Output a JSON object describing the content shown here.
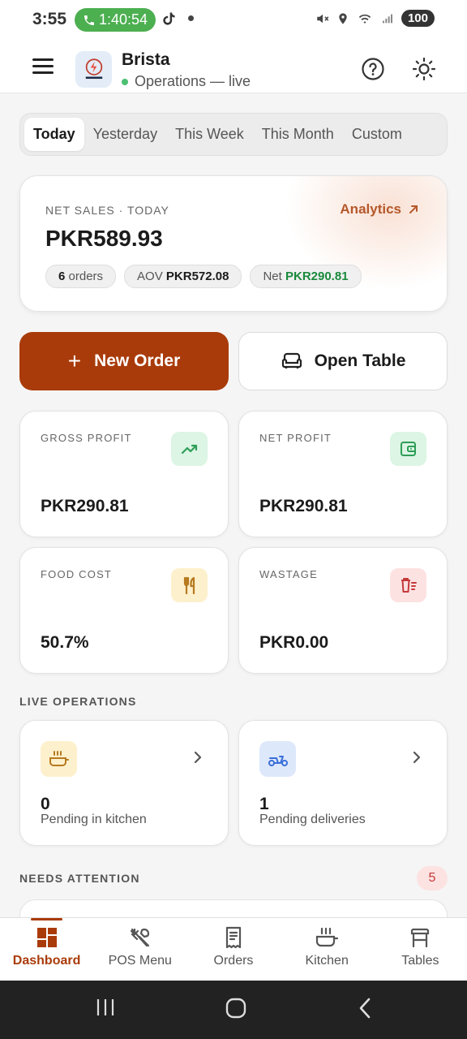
{
  "status_bar": {
    "time": "3:55",
    "call_timer": "1:40:54",
    "battery": "100",
    "icons": [
      "phone-icon",
      "tiktok-icon",
      "mute-icon",
      "location-icon",
      "wifi-icon",
      "signal-icon",
      "battery-icon"
    ]
  },
  "header": {
    "brand": "Brista",
    "status": "Operations — live",
    "icons": [
      "menu-icon",
      "help-icon",
      "theme-icon"
    ]
  },
  "tabs": [
    "Today",
    "Yesterday",
    "This Week",
    "This Month",
    "Custom"
  ],
  "active_tab": "Today",
  "sales": {
    "label": "NET SALES · TODAY",
    "analytics": "Analytics",
    "value": "PKR589.93",
    "orders_count": "6",
    "orders_suffix": "orders",
    "aov_label": "AOV",
    "aov_value": "PKR572.08",
    "net_label": "Net",
    "net_value": "PKR290.81"
  },
  "actions": {
    "new_order": "New Order",
    "open_table": "Open Table"
  },
  "metrics": {
    "gross_profit": {
      "label": "GROSS PROFIT",
      "value": "PKR290.81",
      "icon": "trending-up-icon",
      "color": "#2e9e57"
    },
    "net_profit": {
      "label": "NET PROFIT",
      "value": "PKR290.81",
      "icon": "wallet-icon",
      "color": "#2e9e57"
    },
    "food_cost": {
      "label": "FOOD COST",
      "value": "50.7%",
      "icon": "utensils-icon",
      "color": "#b7791f"
    },
    "wastage": {
      "label": "WASTAGE",
      "value": "PKR0.00",
      "icon": "trash-icon",
      "color": "#c43a3a"
    }
  },
  "live_ops": {
    "title": "LIVE OPERATIONS",
    "kitchen": {
      "count": "0",
      "label": "Pending in kitchen",
      "icon": "cooking-pot-icon"
    },
    "deliveries": {
      "count": "1",
      "label": "Pending deliveries",
      "icon": "scooter-icon"
    }
  },
  "attention": {
    "title": "NEEDS ATTENTION",
    "count": "5"
  },
  "bottom_nav": [
    {
      "label": "Dashboard",
      "icon": "dashboard-icon",
      "active": true
    },
    {
      "label": "POS Menu",
      "icon": "utensils-crossed-icon",
      "active": false
    },
    {
      "label": "Orders",
      "icon": "receipt-icon",
      "active": false
    },
    {
      "label": "Kitchen",
      "icon": "cooking-pot-icon",
      "active": false
    },
    {
      "label": "Tables",
      "icon": "table-icon",
      "active": false
    }
  ],
  "colors": {
    "accent": "#a93b0a",
    "analytics": "#b5582b",
    "positive": "#1a8a3c"
  }
}
